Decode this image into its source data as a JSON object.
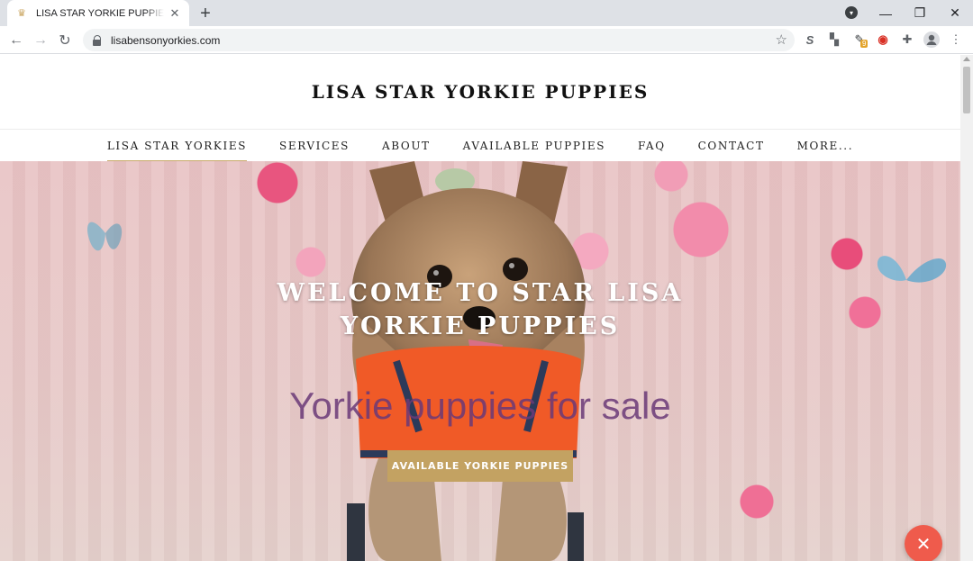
{
  "browser": {
    "tab_title": "LISA STAR YORKIE PUPPIES - Yorkie",
    "url": "lisabensonyorkies.com",
    "new_tab_label": "+",
    "extension_badge": "9"
  },
  "site": {
    "title": "LISA STAR YORKIE PUPPIES",
    "nav": [
      {
        "label": "LISA STAR YORKIES",
        "active": true
      },
      {
        "label": "SERVICES"
      },
      {
        "label": "ABOUT"
      },
      {
        "label": "AVAILABLE PUPPIES"
      },
      {
        "label": "FAQ"
      },
      {
        "label": "CONTACT"
      },
      {
        "label": "MORE..."
      }
    ]
  },
  "hero": {
    "heading": "WELCOME TO STAR LISA YORKIE PUPPIES",
    "subheading": "Yorkie puppies for sale",
    "cta_label": "AVAILABLE YORKIE PUPPIES"
  },
  "colors": {
    "accent": "#c3a262",
    "subheading": "#6b3a78",
    "fab": "#ef5b4c"
  }
}
